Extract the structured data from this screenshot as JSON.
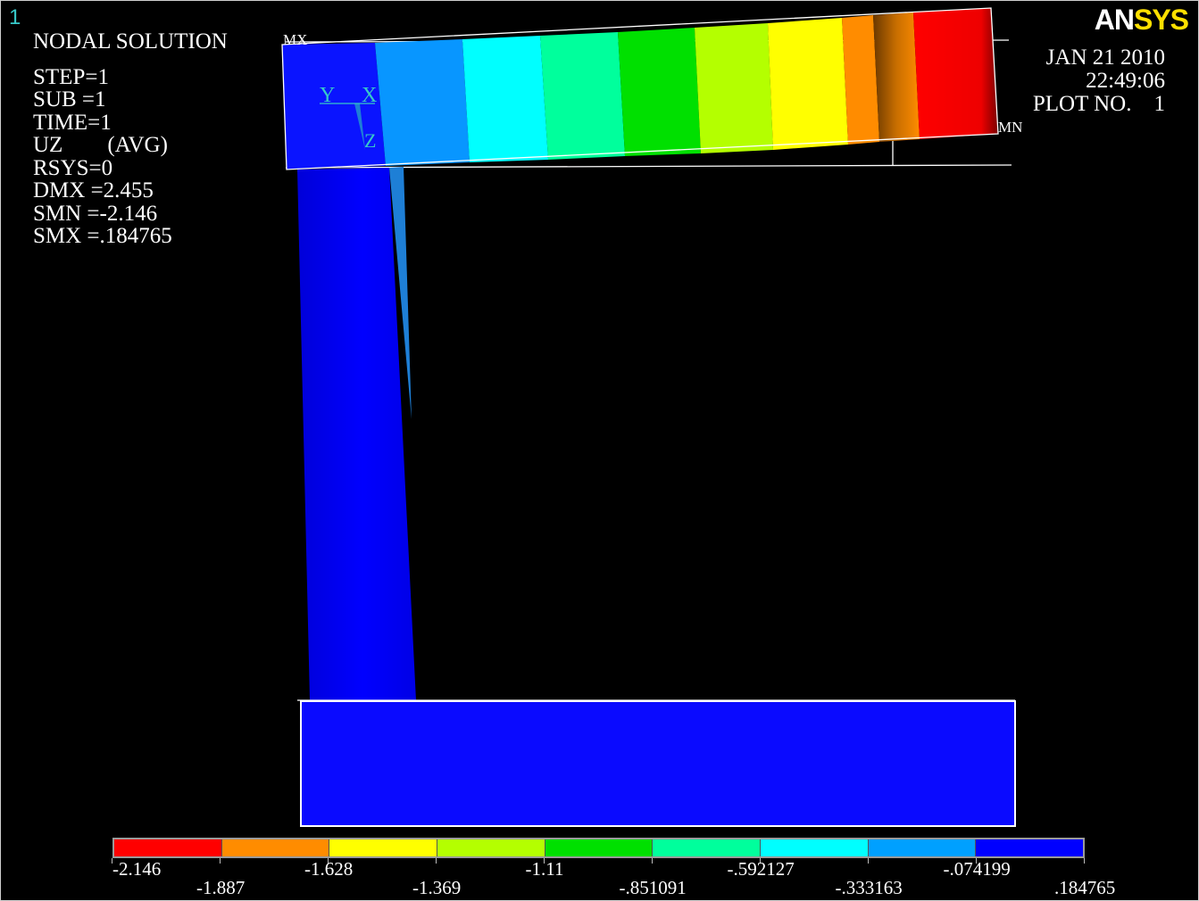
{
  "window": {
    "number": "1"
  },
  "logo": {
    "part1": "AN",
    "part2": "SYS"
  },
  "legend": {
    "title": "NODAL SOLUTION",
    "step": "STEP=1",
    "sub": "SUB =1",
    "time": "TIME=1",
    "quantity": "UZ",
    "avg": "(AVG)",
    "rsys": "RSYS=0",
    "dmx": "DMX =2.455",
    "smn": "SMN =-2.146",
    "smx": "SMX =.184765"
  },
  "header": {
    "date": "JAN 21 2010",
    "time": "22:49:06",
    "plot_no": "PLOT NO.    1"
  },
  "markers": {
    "max": "MX",
    "min": "MN"
  },
  "triad": {
    "y": "Y",
    "x": "X",
    "z": "Z"
  },
  "colorbar": {
    "colors": [
      "#ff0000",
      "#ff8c00",
      "#ffff00",
      "#b4ff00",
      "#00e000",
      "#00ff9c",
      "#00ffff",
      "#00a0ff",
      "#0000ff"
    ],
    "labels_top": [
      "-2.146",
      "-1.628",
      "-1.11",
      "-.592127",
      "-.074199"
    ],
    "labels_bottom": [
      "-1.887",
      "-1.369",
      "-.851091",
      "-.333163",
      ".184765"
    ]
  },
  "colors": {
    "beam_blue": "#0000ff",
    "triad_cyan": "#37c8c8",
    "logo_yellow": "#ffe000"
  }
}
